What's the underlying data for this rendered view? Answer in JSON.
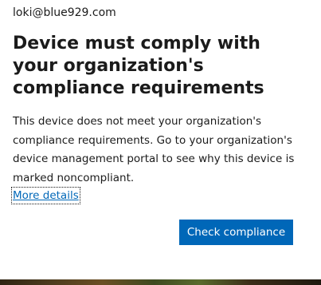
{
  "account": {
    "email": "loki@blue929.com"
  },
  "dialog": {
    "title": "Device must comply with your organization's compliance requirements",
    "body": "This device does not meet your organization's compliance requirements. Go to your organization's device management portal to see why this device is marked noncompliant.",
    "more_details_link": "More details",
    "check_compliance_button": "Check compliance"
  },
  "colors": {
    "accent": "#0067b8",
    "text": "#1b1b1b",
    "background": "#ffffff"
  }
}
